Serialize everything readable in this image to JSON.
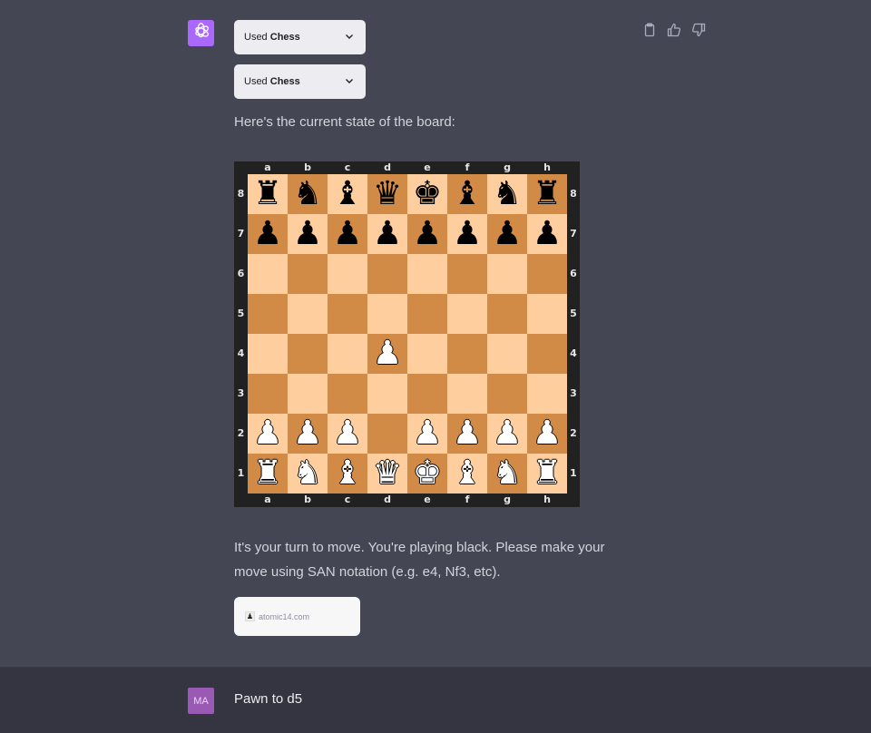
{
  "assistant": {
    "avatar_icon": "openai-logo-icon",
    "avatar_color": "#ab68ff",
    "plugin_calls": [
      {
        "prefix": "Used",
        "plugin": "Chess",
        "icon": "chevron-down-icon"
      },
      {
        "prefix": "Used",
        "plugin": "Chess",
        "icon": "chevron-down-icon"
      }
    ],
    "intro": "Here's the current state of the board:",
    "turn_message": "It's your turn to move. You're playing black. Please make your move using SAN notation (e.g. e4, Nf3, etc).",
    "source": {
      "icon": "chess-pawn-favicon",
      "domain": "atomic14.com"
    },
    "actions": [
      {
        "name": "copy",
        "icon": "clipboard-icon"
      },
      {
        "name": "thumbs-up",
        "icon": "thumbs-up-icon"
      },
      {
        "name": "thumbs-down",
        "icon": "thumbs-down-icon"
      }
    ]
  },
  "board": {
    "files": [
      "a",
      "b",
      "c",
      "d",
      "e",
      "f",
      "g",
      "h"
    ],
    "ranks": [
      "8",
      "7",
      "6",
      "5",
      "4",
      "3",
      "2",
      "1"
    ],
    "light_color": "#ffce9e",
    "dark_color": "#d18b47",
    "position": [
      [
        "bR",
        "bN",
        "bB",
        "bQ",
        "bK",
        "bB",
        "bN",
        "bR"
      ],
      [
        "bP",
        "bP",
        "bP",
        "bP",
        "bP",
        "bP",
        "bP",
        "bP"
      ],
      [
        "",
        "",
        "",
        "",
        "",
        "",
        "",
        ""
      ],
      [
        "",
        "",
        "",
        "",
        "",
        "",
        "",
        ""
      ],
      [
        "",
        "",
        "",
        "wP",
        "",
        "",
        "",
        ""
      ],
      [
        "",
        "",
        "",
        "",
        "",
        "",
        "",
        ""
      ],
      [
        "wP",
        "wP",
        "wP",
        "",
        "wP",
        "wP",
        "wP",
        "wP"
      ],
      [
        "wR",
        "wN",
        "wB",
        "wQ",
        "wK",
        "wB",
        "wN",
        "wR"
      ]
    ]
  },
  "user": {
    "avatar_initials": "MA",
    "avatar_color": "#9b59b6",
    "message": "Pawn to d5"
  }
}
